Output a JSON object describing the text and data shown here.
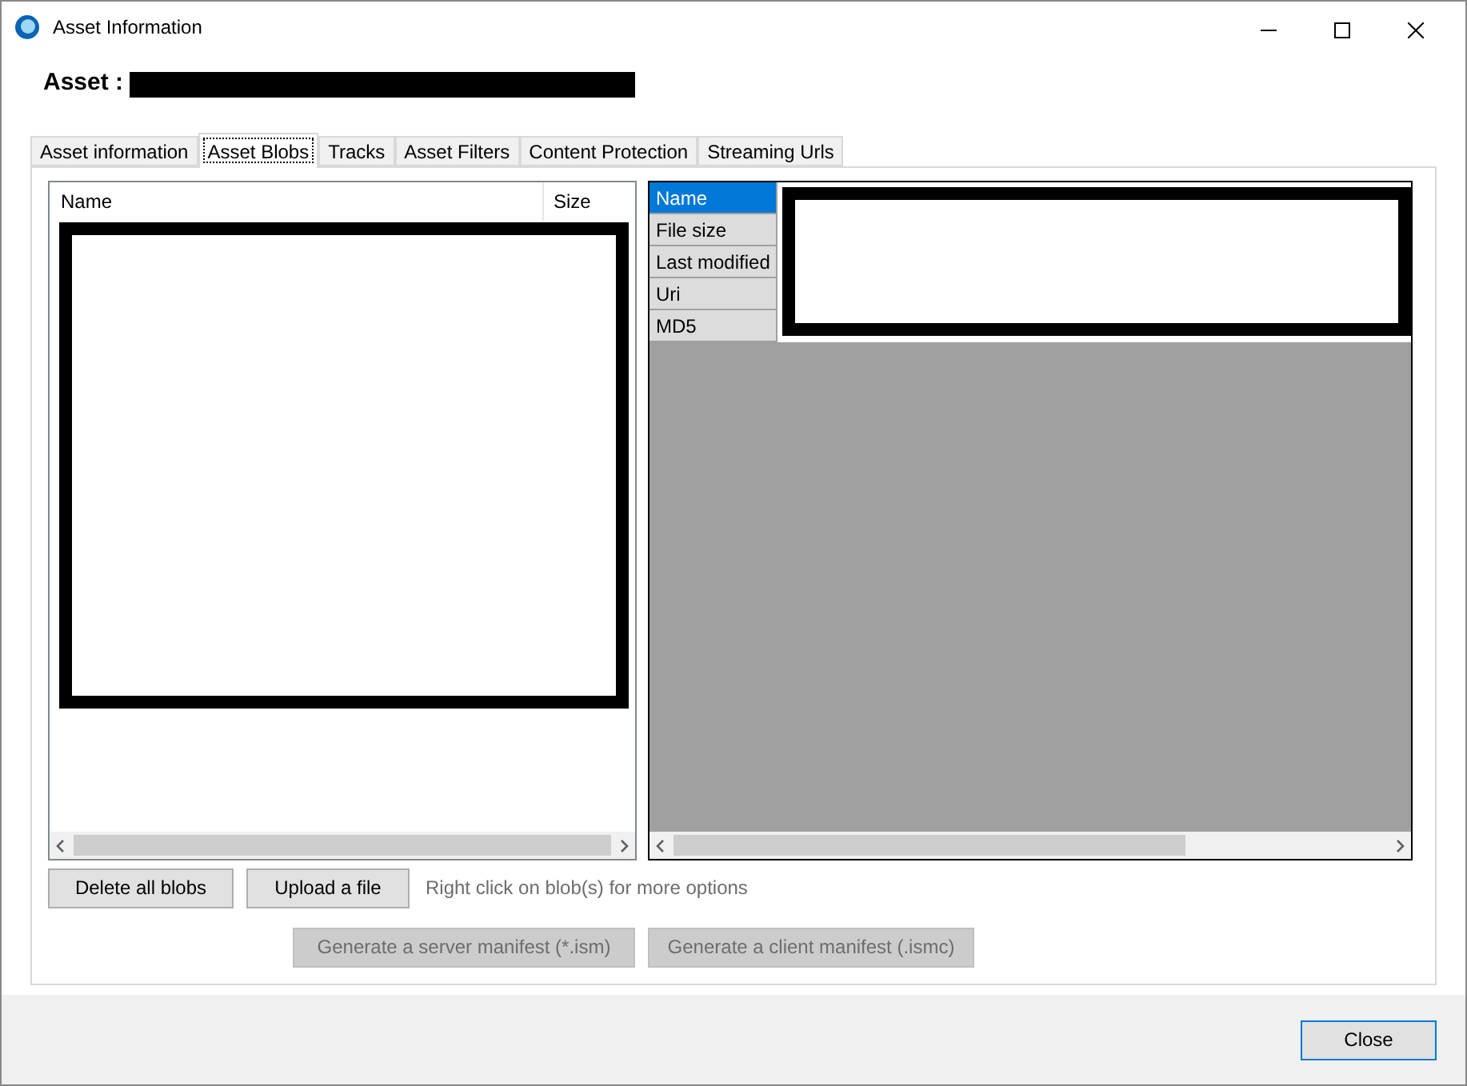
{
  "window": {
    "title": "Asset Information"
  },
  "header": {
    "label": "Asset :"
  },
  "tabs": [
    {
      "label": "Asset information",
      "selected": false
    },
    {
      "label": "Asset Blobs",
      "selected": true
    },
    {
      "label": "Tracks",
      "selected": false
    },
    {
      "label": "Asset Filters",
      "selected": false
    },
    {
      "label": "Content Protection",
      "selected": false
    },
    {
      "label": "Streaming Urls",
      "selected": false
    }
  ],
  "blob_list": {
    "columns": [
      "Name",
      "Size"
    ]
  },
  "properties": {
    "rows": [
      {
        "label": "Name",
        "selected": true
      },
      {
        "label": "File size",
        "selected": false
      },
      {
        "label": "Last modified",
        "selected": false
      },
      {
        "label": "Uri",
        "selected": false
      },
      {
        "label": "MD5",
        "selected": false
      }
    ]
  },
  "actions": [
    {
      "label": "Delete all blobs",
      "disabled": false
    },
    {
      "label": "Upload a file",
      "disabled": false
    }
  ],
  "hint": "Right click on blob(s) for more options",
  "manifest_buttons": [
    {
      "label": "Generate a server manifest (*.ism)",
      "disabled": true
    },
    {
      "label": "Generate a client manifest (.ismc)",
      "disabled": true
    }
  ],
  "close_button": "Close"
}
